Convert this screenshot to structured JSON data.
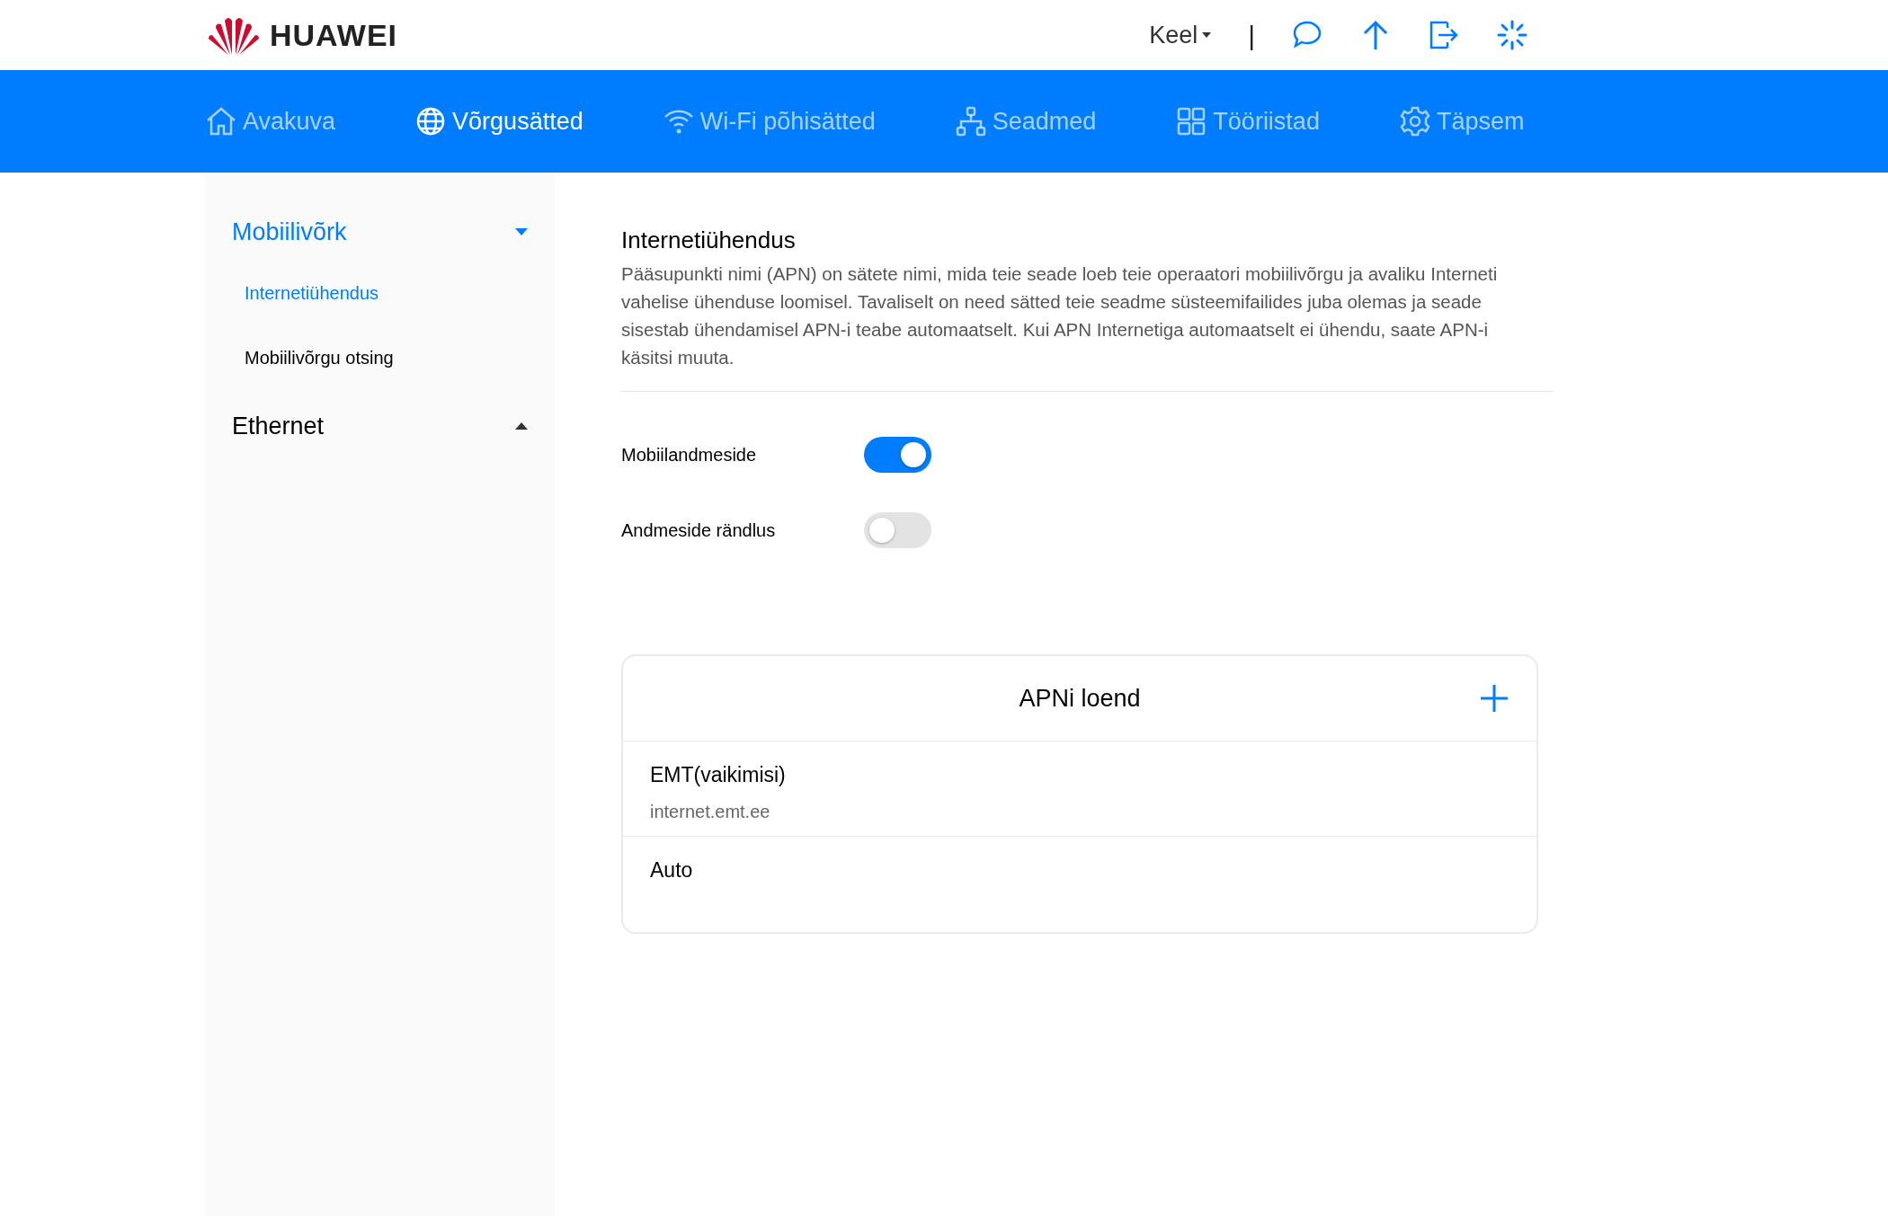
{
  "header": {
    "brand": "HUAWEI",
    "language": "Keel",
    "separator": "|"
  },
  "nav": [
    {
      "label": "Avakuva",
      "selected": false
    },
    {
      "label": "Võrgusätted",
      "selected": true
    },
    {
      "label": "Wi-Fi põhisätted",
      "selected": false
    },
    {
      "label": "Seadmed",
      "selected": false
    },
    {
      "label": "Tööriistad",
      "selected": false
    },
    {
      "label": "Täpsem",
      "selected": false
    }
  ],
  "sidebar": [
    {
      "label": "Mobiilivõrk",
      "expanded": true,
      "selected": true,
      "children": [
        {
          "label": "Internetiühendus",
          "selected": true
        },
        {
          "label": "Mobiilivõrgu otsing",
          "selected": false
        }
      ]
    },
    {
      "label": "Ethernet",
      "expanded": false,
      "selected": false
    }
  ],
  "section": {
    "title": "Internetiühendus",
    "description": "Pääsupunkti nimi (APN) on sätete nimi, mida teie seade loeb teie operaatori mobiilivõrgu ja avaliku Interneti vahelise ühenduse loomisel. Tavaliselt on need sätted teie seadme süsteemifailides juba olemas ja seade sisestab ühendamisel APN-i teabe automaatselt. Kui APN Internetiga automaatselt ei ühendu, saate APN-i käsitsi muuta."
  },
  "settings": [
    {
      "label": "Mobiilandmeside",
      "on": true
    },
    {
      "label": "Andmeside rändlus",
      "on": false
    }
  ],
  "apn_list": {
    "title": "APNi loend",
    "items": [
      {
        "name": "EMT(vaikimisi)",
        "apn": "internet.emt.ee"
      },
      {
        "name": "Auto"
      }
    ]
  }
}
